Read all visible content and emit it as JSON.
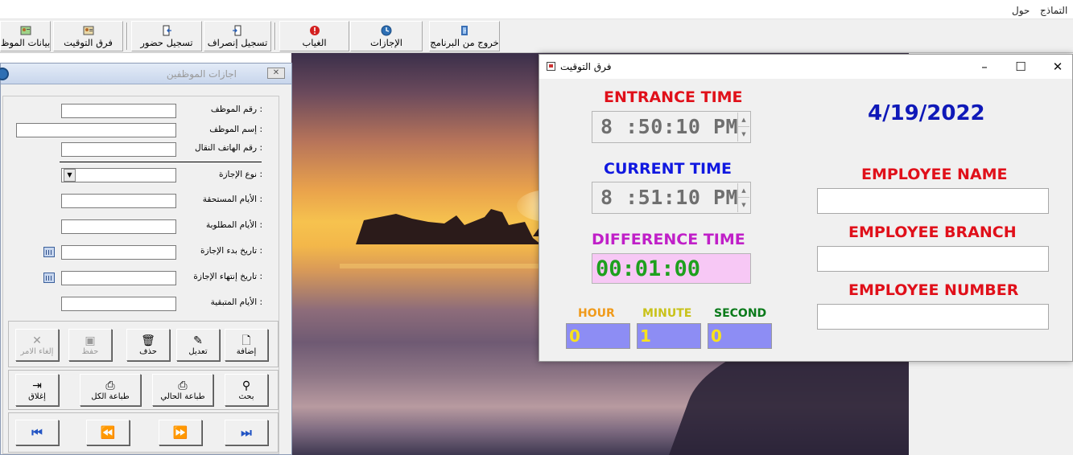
{
  "menu": {
    "item1": "التماذج",
    "item2": "حول"
  },
  "toolbar": {
    "exit": "خروج من البرنامج",
    "leaves": "الإجازات",
    "absence": "الغياب",
    "checkout": "تسجيل إنصراف",
    "checkin": "تسجيل حضور",
    "time_diff": "فرق التوقيت",
    "employee_data": "بيانات الموظ"
  },
  "leave_window": {
    "title": "اجازات الموظفين",
    "fields": {
      "employee_id": "رقم الموظف :",
      "employee_name": "إسم الموظف :",
      "mobile": "رقم الهاتف النقال :",
      "leave_type": "نوع الإجازة :",
      "due_days": "الأيام المستحقة :",
      "requested_days": "الأيام المطلوبة :",
      "start_date": "تاريخ بدء الإجازة :",
      "end_date": "تاريخ إنتهاء الإجازة :",
      "remaining_days": "الأيام المتبقية :"
    },
    "buttons": {
      "add": "إضافة",
      "edit": "تعديل",
      "delete": "حذف",
      "save": "حفظ",
      "cancel": "إلغاء الامر",
      "search": "بحث",
      "print_current": "طباعة الحالي",
      "print_all": "طباعة الكل",
      "close": "إغلاق"
    },
    "nav": {
      "last": "⏭",
      "next": "⏩",
      "prev": "⏪",
      "first": "⏮"
    }
  },
  "time_window": {
    "title": "فرق التوقيت",
    "entrance_label": "ENTRANCE TIME",
    "entrance_value": "8 :50:10 PM",
    "current_label": "CURRENT TIME",
    "current_value": "8 :51:10 PM",
    "difference_label": "DIFFERENCE TIME",
    "difference_value": "00:01:00",
    "date": "4/19/2022",
    "employee_name_label": "EMPLOYEE NAME",
    "employee_branch_label": "EMPLOYEE BRANCH",
    "employee_number_label": "EMPLOYEE NUMBER",
    "employee_name_value": "",
    "employee_branch_value": "",
    "employee_number_value": "",
    "hour_label": "HOUR",
    "minute_label": "MINUTE",
    "second_label": "SECOND",
    "hour_value": "0",
    "minute_value": "1",
    "second_value": "0"
  },
  "colors": {
    "red_label": "#e0101a",
    "blue_label": "#1018e0",
    "magenta_label": "#c020c8",
    "date_blue": "#0f19b8",
    "hour_orange": "#f09a1a",
    "minute_yellow": "#c9c21a",
    "second_green": "#0a7a1a",
    "num_bg": "#8d8df4",
    "num_fg": "#f7e21d",
    "diff_bg": "#f7c8f5",
    "diff_fg": "#1ea01e"
  }
}
